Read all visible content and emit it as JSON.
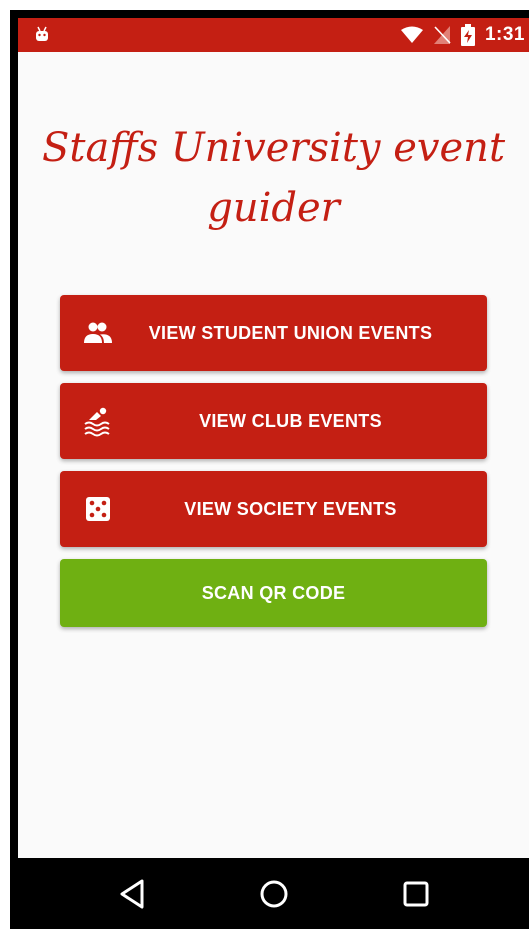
{
  "status_bar": {
    "time": "1:31",
    "icons": [
      "android-debug-icon",
      "wifi-icon",
      "no-sim-icon",
      "battery-charging-icon"
    ],
    "color": "#c41f13"
  },
  "app": {
    "title": "Staffs University event guider"
  },
  "buttons": [
    {
      "label": "VIEW STUDENT UNION EVENTS",
      "icon": "people-icon",
      "color": "#c41f13"
    },
    {
      "label": "VIEW CLUB EVENTS",
      "icon": "swimming-icon",
      "color": "#c41f13"
    },
    {
      "label": "VIEW SOCIETY EVENTS",
      "icon": "dice-icon",
      "color": "#c41f13"
    },
    {
      "label": "SCAN QR CODE",
      "color": "#6fb012"
    }
  ],
  "nav_bar": {
    "icons": [
      "back-icon",
      "home-icon",
      "recents-icon"
    ]
  }
}
